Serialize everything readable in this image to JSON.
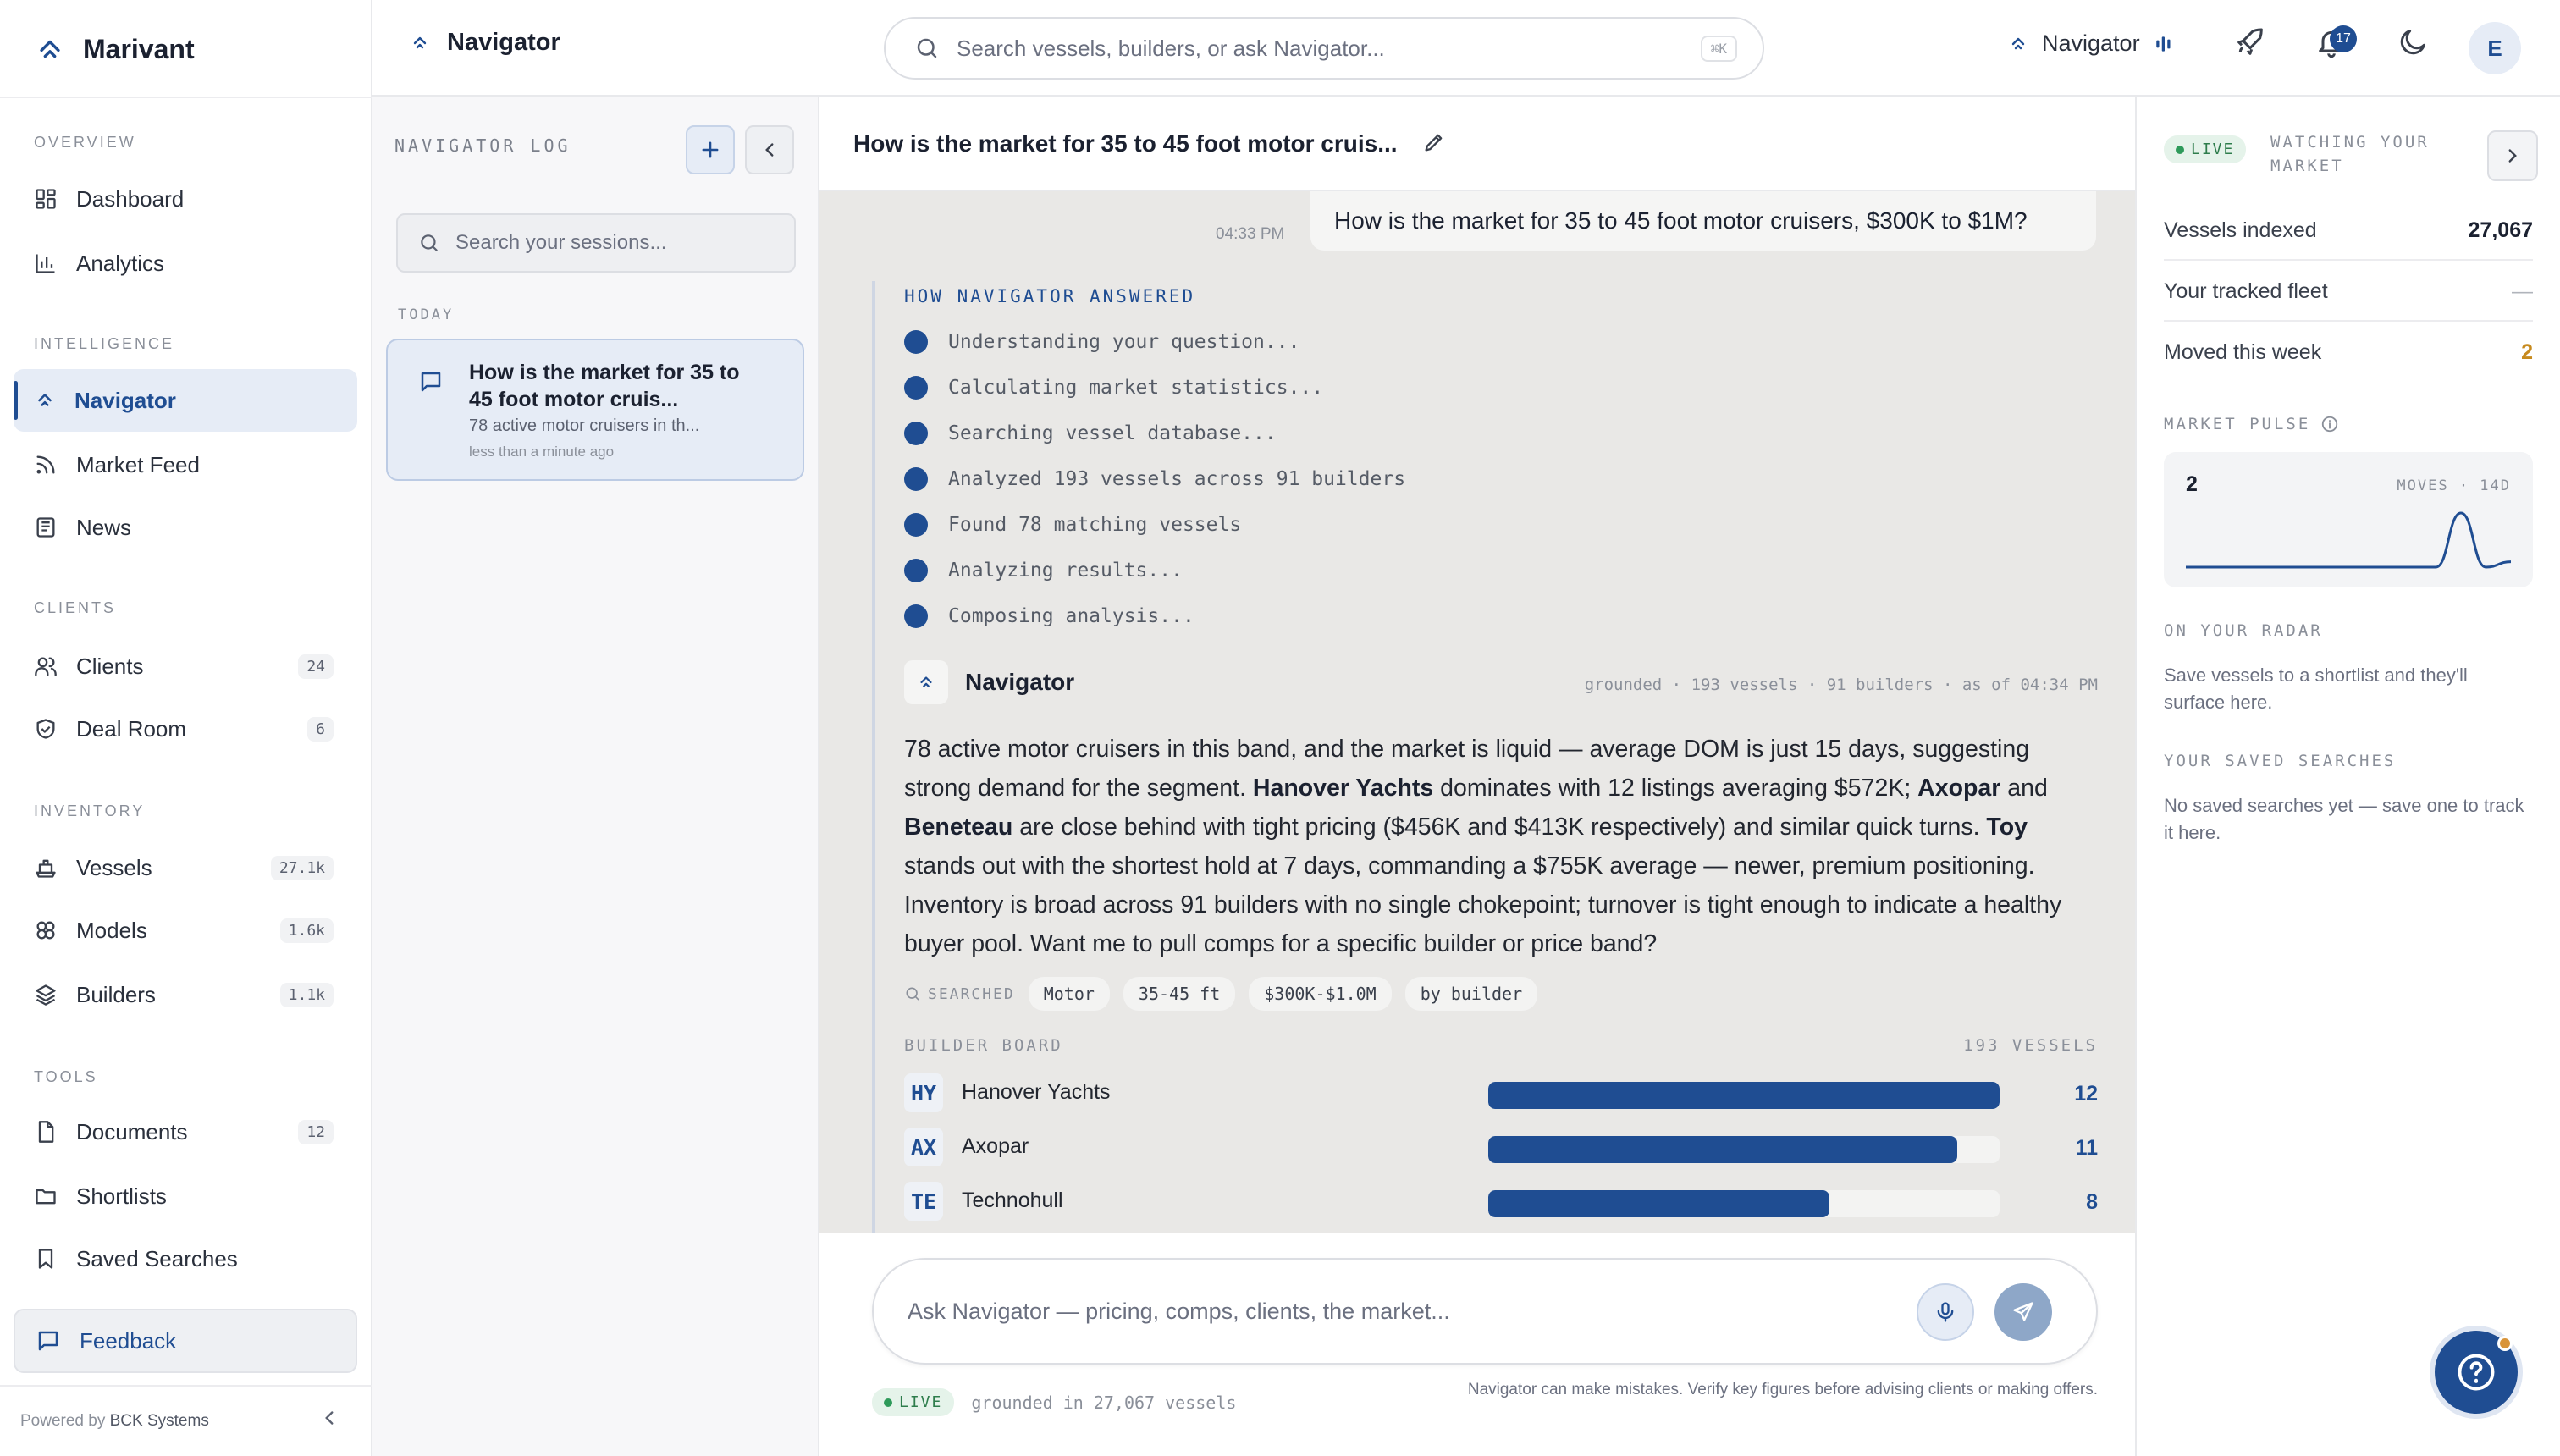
{
  "brand": {
    "name": "Marivant"
  },
  "sidebar": {
    "sections": {
      "overview": "OVERVIEW",
      "intelligence": "INTELLIGENCE",
      "clients": "CLIENTS",
      "inventory": "INVENTORY",
      "tools": "TOOLS"
    },
    "items": [
      {
        "label": "Dashboard",
        "icon": "dashboard-icon"
      },
      {
        "label": "Analytics",
        "icon": "bar-chart-icon"
      },
      {
        "label": "Navigator",
        "icon": "chevron-up-double-icon",
        "active": true
      },
      {
        "label": "Market Feed",
        "icon": "rss-icon"
      },
      {
        "label": "News",
        "icon": "newspaper-icon"
      },
      {
        "label": "Clients",
        "icon": "users-icon",
        "badge": "24"
      },
      {
        "label": "Deal Room",
        "icon": "handshake-icon",
        "badge": "6"
      },
      {
        "label": "Vessels",
        "icon": "ship-icon",
        "badge": "27.1k"
      },
      {
        "label": "Models",
        "icon": "cube-icon",
        "badge": "1.6k"
      },
      {
        "label": "Builders",
        "icon": "layers-icon",
        "badge": "1.1k"
      },
      {
        "label": "Documents",
        "icon": "document-icon",
        "badge": "12"
      },
      {
        "label": "Shortlists",
        "icon": "folder-icon"
      },
      {
        "label": "Saved Searches",
        "icon": "bookmark-icon"
      }
    ],
    "feedback": "Feedback",
    "powered_prefix": "Powered by",
    "powered_brand": "BCK Systems"
  },
  "topbar": {
    "title": "Navigator",
    "search_placeholder": "Search vessels, builders, or ask Navigator...",
    "shortcut": "⌘K",
    "nav_label": "Navigator",
    "notifications": "17",
    "avatar": "E"
  },
  "sessions": {
    "heading": "NAVIGATOR LOG",
    "search_placeholder": "Search your sessions...",
    "group": "TODAY",
    "items": [
      {
        "title": "How is the market for 35 to 45 foot motor cruis...",
        "snippet": "78 active motor cruisers in th...",
        "time": "less than a minute ago"
      }
    ]
  },
  "chat": {
    "title": "How is the market for 35 to 45 foot motor cruis...",
    "user_message": "How is the market for 35 to 45 foot motor cruisers, $300K to $1M?",
    "user_time": "04:33 PM",
    "how_heading": "HOW NAVIGATOR ANSWERED",
    "steps": [
      "Understanding your question...",
      "Calculating market statistics...",
      "Searching vessel database...",
      "Analyzed 193 vessels across 91 builders",
      "Found 78 matching vessels",
      "Analyzing results...",
      "Composing analysis..."
    ],
    "assistant_name": "Navigator",
    "assistant_meta": "grounded · 193 vessels · 91 builders · as of 04:34 PM",
    "answer": {
      "p1": "78 active motor cruisers in this band, and the market is liquid — average DOM is just 15 days, suggesting strong demand for the segment. ",
      "b1": "Hanover Yachts",
      "p2": " dominates with 12 listings averaging $572K; ",
      "b2": "Axopar",
      "p3": " and ",
      "b3": "Beneteau",
      "p4": " are close behind with tight pricing ($456K and $413K respectively) and similar quick turns. ",
      "b4": "Toy",
      "p5": " stands out with the shortest hold at 7 days, commanding a $755K average — newer, premium positioning. Inventory is broad across 91 builders with no single chokepoint; turnover is tight enough to indicate a healthy buyer pool. Want me to pull comps for a specific builder or price band?"
    },
    "searched_label": "SEARCHED",
    "filters": [
      "Motor",
      "35-45 ft",
      "$300K-$1.0M",
      "by builder"
    ],
    "board_heading": "BUILDER BOARD",
    "board_total": "193 VESSELS",
    "board_max": 12,
    "builders": [
      {
        "code": "HY",
        "name": "Hanover Yachts",
        "count": 12
      },
      {
        "code": "AX",
        "name": "Axopar",
        "count": 11
      },
      {
        "code": "TE",
        "name": "Technohull",
        "count": 8
      }
    ],
    "composer_placeholder": "Ask Navigator — pricing, comps, clients, the market...",
    "live": "LIVE",
    "grounded": "grounded in 27,067 vessels",
    "disclaimer": "Navigator can make mistakes. Verify key figures before advising clients or making offers."
  },
  "right_panel": {
    "live": "LIVE",
    "watching": "WATCHING YOUR MARKET",
    "stats": [
      {
        "label": "Vessels indexed",
        "value": "27,067"
      },
      {
        "label": "Your tracked fleet",
        "value": "—"
      },
      {
        "label": "Moved this week",
        "value": "2"
      }
    ],
    "pulse_heading": "MARKET PULSE",
    "pulse_value": "2",
    "pulse_caption": "MOVES · 14D",
    "pulse_series": [
      0,
      0,
      0,
      0,
      0,
      0,
      0,
      0,
      0,
      0,
      0,
      2,
      0,
      0.2
    ],
    "radar_heading": "ON YOUR RADAR",
    "radar_text": "Save vessels to a shortlist and they'll surface here.",
    "saved_heading": "YOUR SAVED SEARCHES",
    "saved_text": "No saved searches yet — save one to track it here."
  },
  "colors": {
    "accent": "#1f4d92",
    "live": "#2e9a5a",
    "gold": "#c78a1e"
  }
}
